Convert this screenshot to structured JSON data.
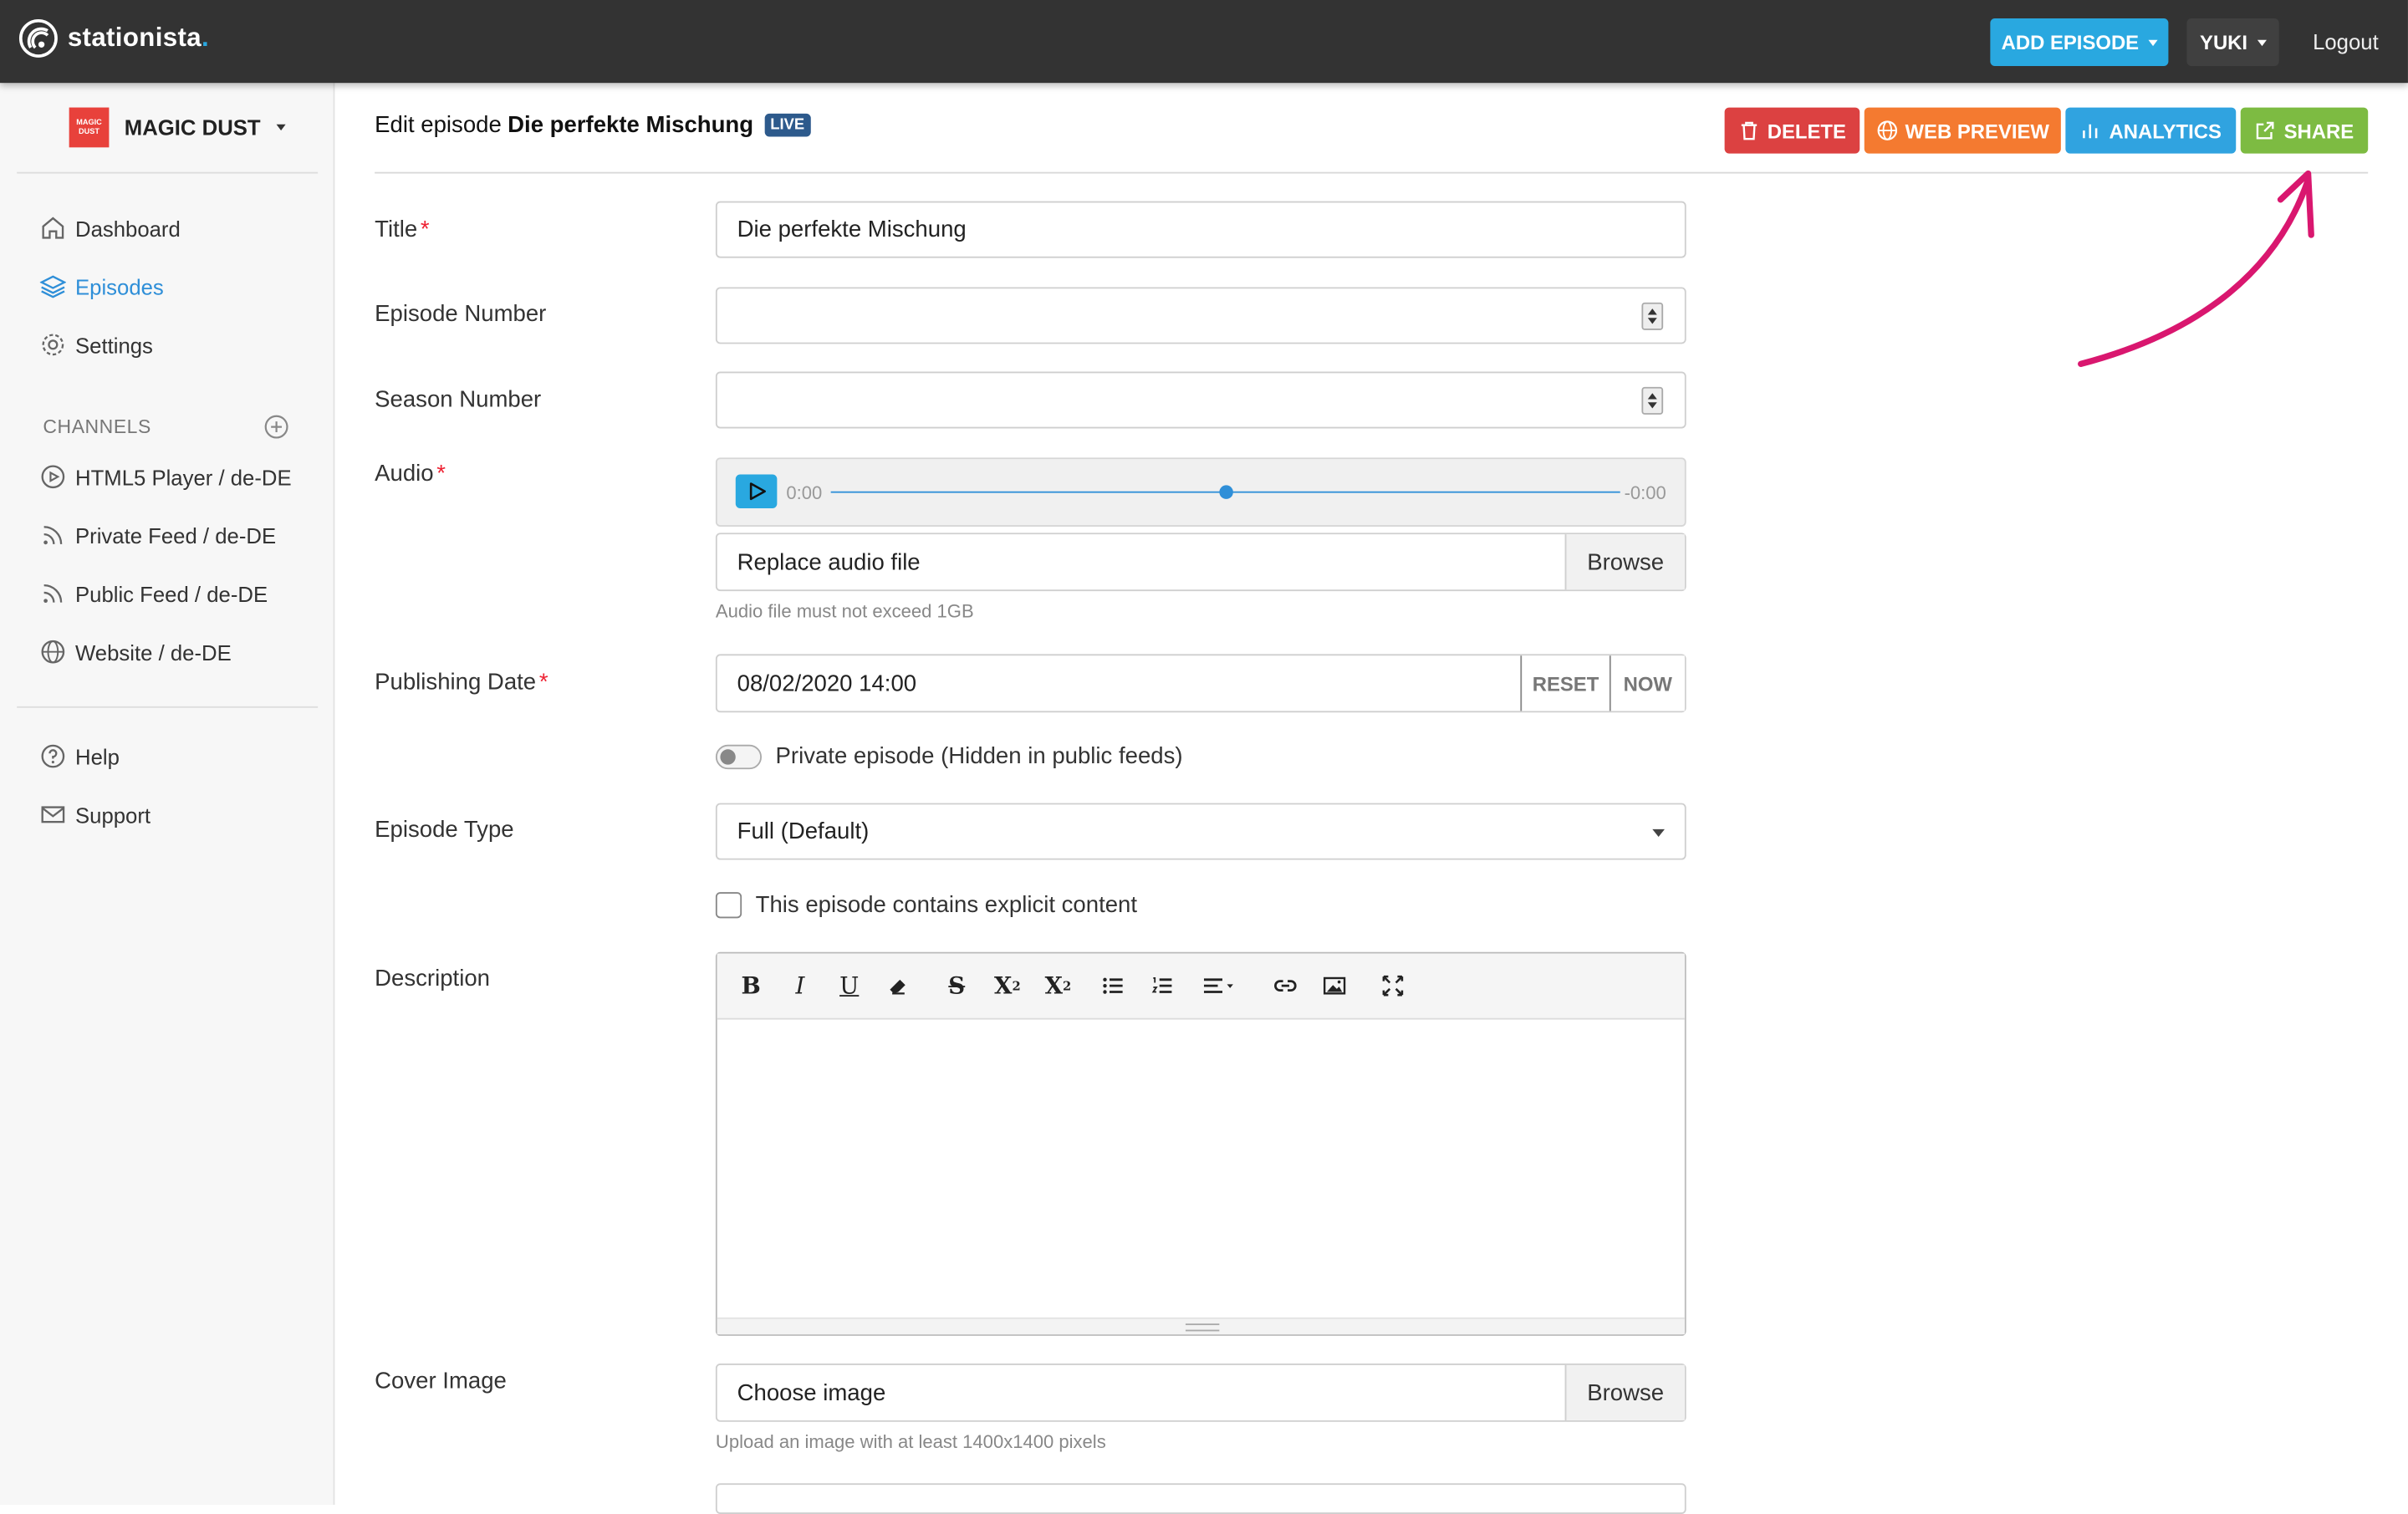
{
  "topbar": {
    "logo_text": "stationista",
    "logo_dot": ".",
    "add_episode": "ADD EPISODE",
    "user": "YUKI",
    "logout": "Logout"
  },
  "sidebar": {
    "org_logo_text": "MAGIC DUST",
    "org_name": "MAGIC DUST",
    "nav": [
      {
        "label": "Dashboard",
        "icon": "home-icon"
      },
      {
        "label": "Episodes",
        "icon": "layers-icon"
      },
      {
        "label": "Settings",
        "icon": "gear-icon"
      }
    ],
    "channels_heading": "CHANNELS",
    "channels": [
      {
        "label": "HTML5 Player / de-DE",
        "icon": "play-circle-icon"
      },
      {
        "label": "Private Feed / de-DE",
        "icon": "rss-icon"
      },
      {
        "label": "Public Feed / de-DE",
        "icon": "rss-icon"
      },
      {
        "label": "Website / de-DE",
        "icon": "globe-icon"
      }
    ],
    "help": [
      {
        "label": "Help",
        "icon": "question-circle-icon"
      },
      {
        "label": "Support",
        "icon": "envelope-icon"
      }
    ]
  },
  "header": {
    "prefix": "Edit episode",
    "episode_title": "Die perfekte Mischung",
    "badge": "LIVE",
    "actions": {
      "delete": "DELETE",
      "web_preview": "WEB PREVIEW",
      "analytics": "ANALYTICS",
      "share": "SHARE"
    }
  },
  "form": {
    "title_label": "Title",
    "title_value": "Die perfekte Mischung",
    "episode_number_label": "Episode Number",
    "episode_number_value": "",
    "season_number_label": "Season Number",
    "season_number_value": "",
    "audio_label": "Audio",
    "audio_time_start": "0:00",
    "audio_time_end": "-0:00",
    "audio_progress": 0.5,
    "audio_file_placeholder": "Replace audio file",
    "browse": "Browse",
    "audio_hint": "Audio file must not exceed 1GB",
    "publishing_date_label": "Publishing Date",
    "publishing_date_value": "08/02/2020 14:00",
    "reset": "RESET",
    "now": "NOW",
    "private_label": "Private episode (Hidden in public feeds)",
    "private_enabled": false,
    "episode_type_label": "Episode Type",
    "episode_type_value": "Full (Default)",
    "explicit_label": "This episode contains explicit content",
    "explicit_checked": false,
    "description_label": "Description",
    "description_toolbar": [
      "bold",
      "italic",
      "underline",
      "eraser",
      "strikethrough",
      "superscript",
      "subscript",
      "bullet-list",
      "numbered-list",
      "align",
      "link",
      "image",
      "fullscreen"
    ],
    "cover_label": "Cover Image",
    "cover_placeholder": "Choose image",
    "cover_hint": "Upload an image with at least 1400x1400 pixels"
  },
  "colors": {
    "topbar": "#333333",
    "accent_blue": "#29a8e0",
    "delete": "#dc4141",
    "preview": "#f47a30",
    "analytics": "#30a3e0",
    "share": "#7dbb42",
    "live_badge": "#2d5a8c",
    "annotation_arrow": "#d9176f"
  }
}
